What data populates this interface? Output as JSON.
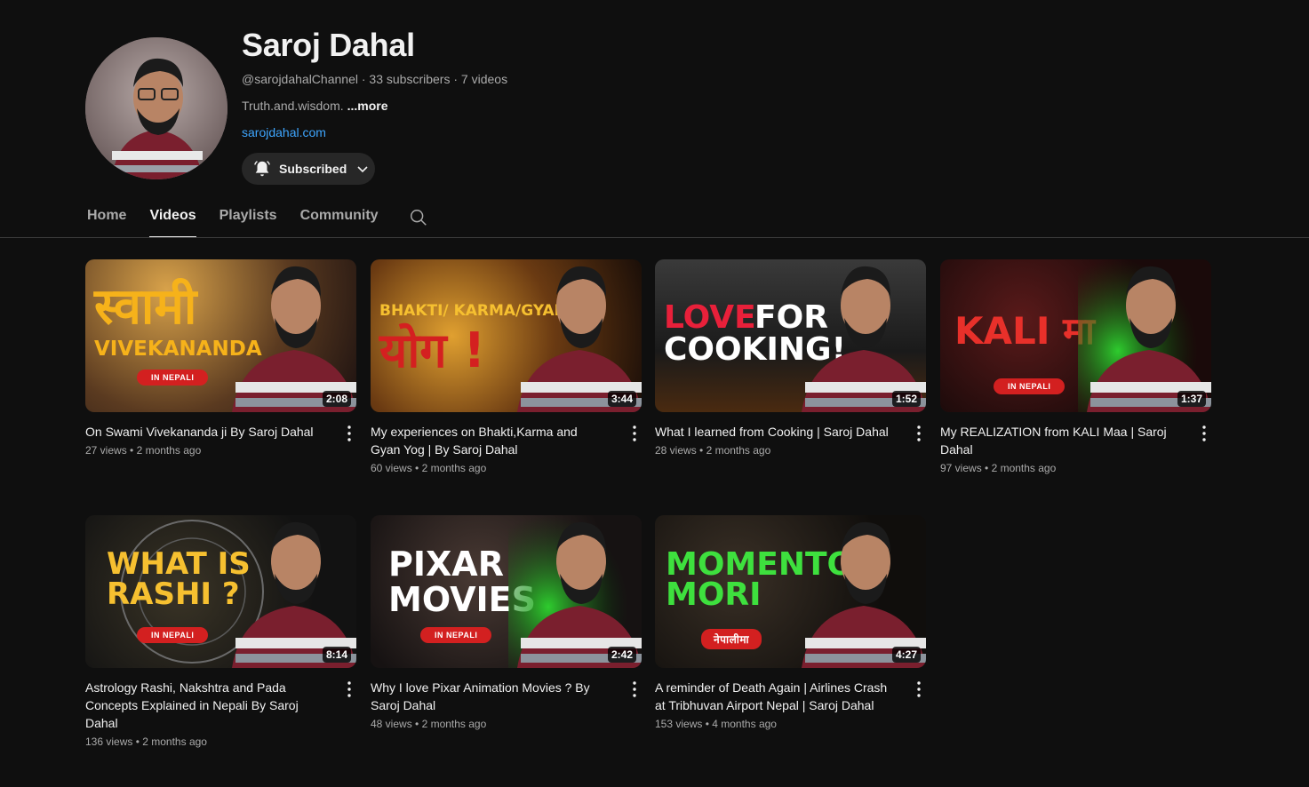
{
  "channel": {
    "name": "Saroj Dahal",
    "handle": "@sarojdahalChannel",
    "subscribers": "33 subscribers",
    "videos_count": "7 videos",
    "description": "Truth.and.wisdom.",
    "more_label": "...more",
    "link": "sarojdahal.com",
    "subscribe_label": "Subscribed"
  },
  "tabs": [
    {
      "label": "Home"
    },
    {
      "label": "Videos"
    },
    {
      "label": "Playlists"
    },
    {
      "label": "Community"
    }
  ],
  "videos": [
    {
      "title": "On Swami Vivekananda ji By Saroj Dahal",
      "views": "27 views",
      "age": "2 months ago",
      "duration": "2:08",
      "art": [
        "स्वामी",
        "VIVEKANANDA"
      ],
      "pill": "IN NEPALI"
    },
    {
      "title": "My experiences on Bhakti,Karma and Gyan Yog | By Saroj Dahal",
      "views": "60 views",
      "age": "2 months ago",
      "duration": "3:44",
      "art": [
        "BHAKTI/ KARMA/GYAN",
        "योग !"
      ],
      "pill": ""
    },
    {
      "title": "What I learned from Cooking | Saroj Dahal",
      "views": "28 views",
      "age": "2 months ago",
      "duration": "1:52",
      "art": [
        "LOVE",
        "FOR",
        "COOKING!"
      ],
      "pill": ""
    },
    {
      "title": "My REALIZATION from KALI Maa | Saroj Dahal",
      "views": "97 views",
      "age": "2 months ago",
      "duration": "1:37",
      "art": [
        "KALI मा"
      ],
      "pill": "IN NEPALI"
    },
    {
      "title": "Astrology Rashi, Nakshtra and Pada Concepts Explained in Nepali By Saroj Dahal",
      "views": "136 views",
      "age": "2 months ago",
      "duration": "8:14",
      "art": [
        "WHAT IS",
        "RASHI ?"
      ],
      "pill": "IN NEPALI"
    },
    {
      "title": "Why I love Pixar Animation Movies ? By Saroj Dahal",
      "views": "48 views",
      "age": "2 months ago",
      "duration": "2:42",
      "art": [
        "PIXAR",
        "MOVIES"
      ],
      "pill": "IN NEPALI"
    },
    {
      "title": "A reminder of Death Again | Airlines Crash at Tribhuvan Airport Nepal | Saroj Dahal",
      "views": "153 views",
      "age": "4 months ago",
      "duration": "4:27",
      "art": [
        "MOMENTO",
        "MORI"
      ],
      "pill": "नेपालीमा"
    }
  ],
  "colors": {
    "accent_link": "#3ea6ff",
    "background": "#0f0f0f",
    "pill_red": "#d32020"
  }
}
